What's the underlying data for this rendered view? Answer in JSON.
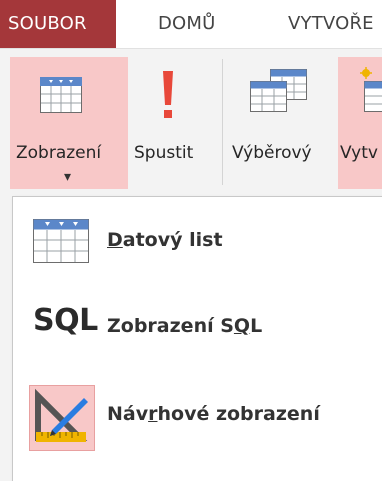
{
  "tabs": [
    {
      "label": "SOUBOR",
      "active": true
    },
    {
      "label": "DOMŮ",
      "active": false
    },
    {
      "label": "VYTVOŘE",
      "active": false
    }
  ],
  "ribbon": {
    "view_button": {
      "label": "Zobrazení",
      "icon": "datasheet-grid-icon",
      "dropdown_arrow": "▾"
    },
    "run_button": {
      "label": "Spustit",
      "icon": "exclamation-icon"
    },
    "select_button": {
      "label": "Výběrový",
      "icon": "select-query-grid-icon"
    },
    "create_button": {
      "label": "Vytv",
      "icon": "make-table-icon"
    }
  },
  "view_menu": {
    "items": [
      {
        "label_prefix": "",
        "label_underline": "D",
        "label_suffix": "atový list",
        "icon": "datasheet-grid-icon"
      },
      {
        "label_prefix": "Zobrazení S",
        "label_underline": "Q",
        "label_suffix": "L",
        "icon": "sql-icon",
        "icon_text": "SQL"
      },
      {
        "label_prefix": "Náv",
        "label_underline": "r",
        "label_suffix": "hové zobrazení",
        "icon": "design-view-icon",
        "selected": true
      }
    ]
  },
  "colors": {
    "accent_tab": "#a4373a",
    "pressed": "#f8c8c8",
    "run_icon": "#e8483a",
    "grid_blue": "#5b87c9"
  }
}
